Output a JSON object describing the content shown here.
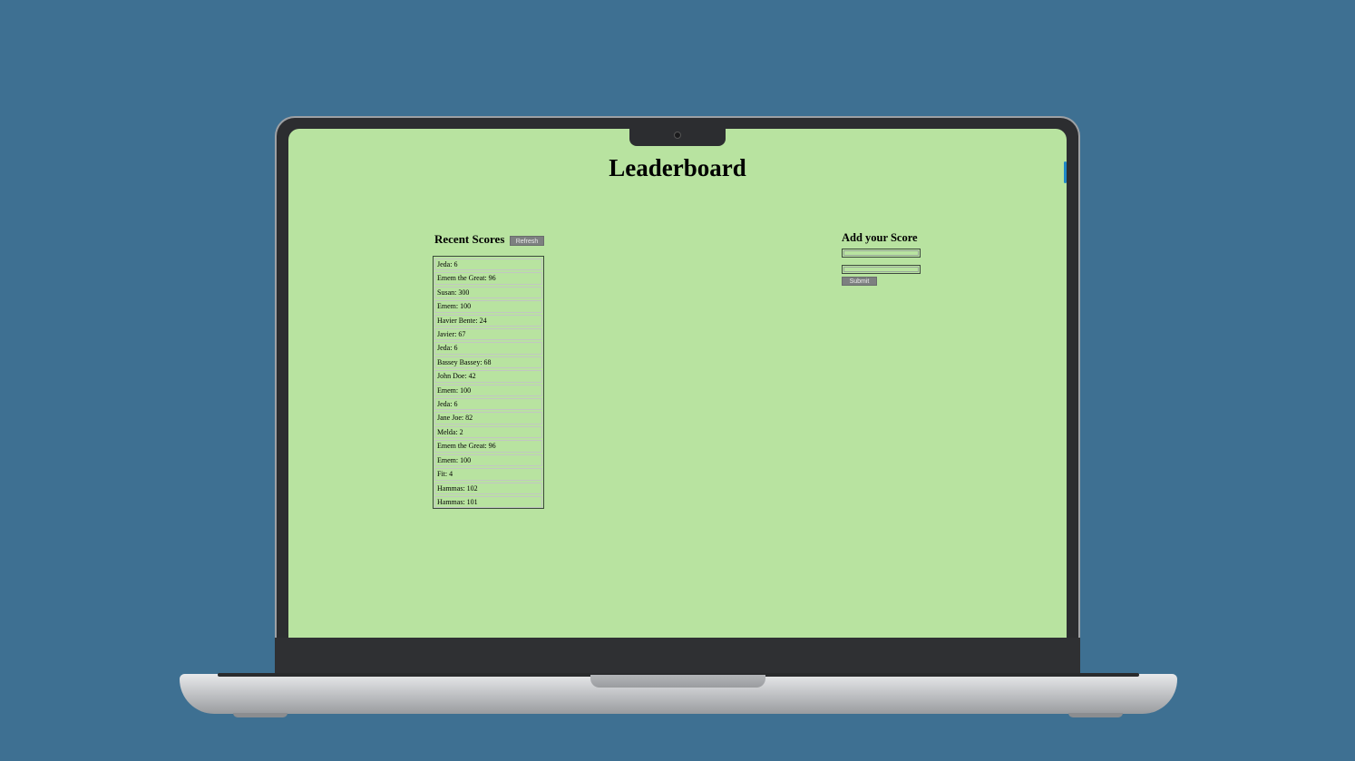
{
  "page": {
    "title": "Leaderboard"
  },
  "recent_scores": {
    "heading": "Recent Scores",
    "refresh_label": "Refresh",
    "items": [
      "Jeda: 6",
      "Emem the Great: 96",
      "Susan: 300",
      "Emem: 100",
      "Havier Bente: 24",
      "Javier: 67",
      "Jeda: 6",
      "Bassey Bassey: 68",
      "John Doe: 42",
      "Emem: 100",
      "Jeda: 6",
      "Jane Joe: 82",
      "Melda: 2",
      "Emem the Great: 96",
      "Emem: 100",
      "Fit: 4",
      "Hammas: 102",
      "Hammas: 101"
    ]
  },
  "add_score": {
    "heading": "Add your Score",
    "name_value": "",
    "score_value": "",
    "submit_label": "Submit"
  },
  "colors": {
    "background": "#3e7092",
    "screen": "#b8e3a0",
    "button": "#7d8080"
  }
}
